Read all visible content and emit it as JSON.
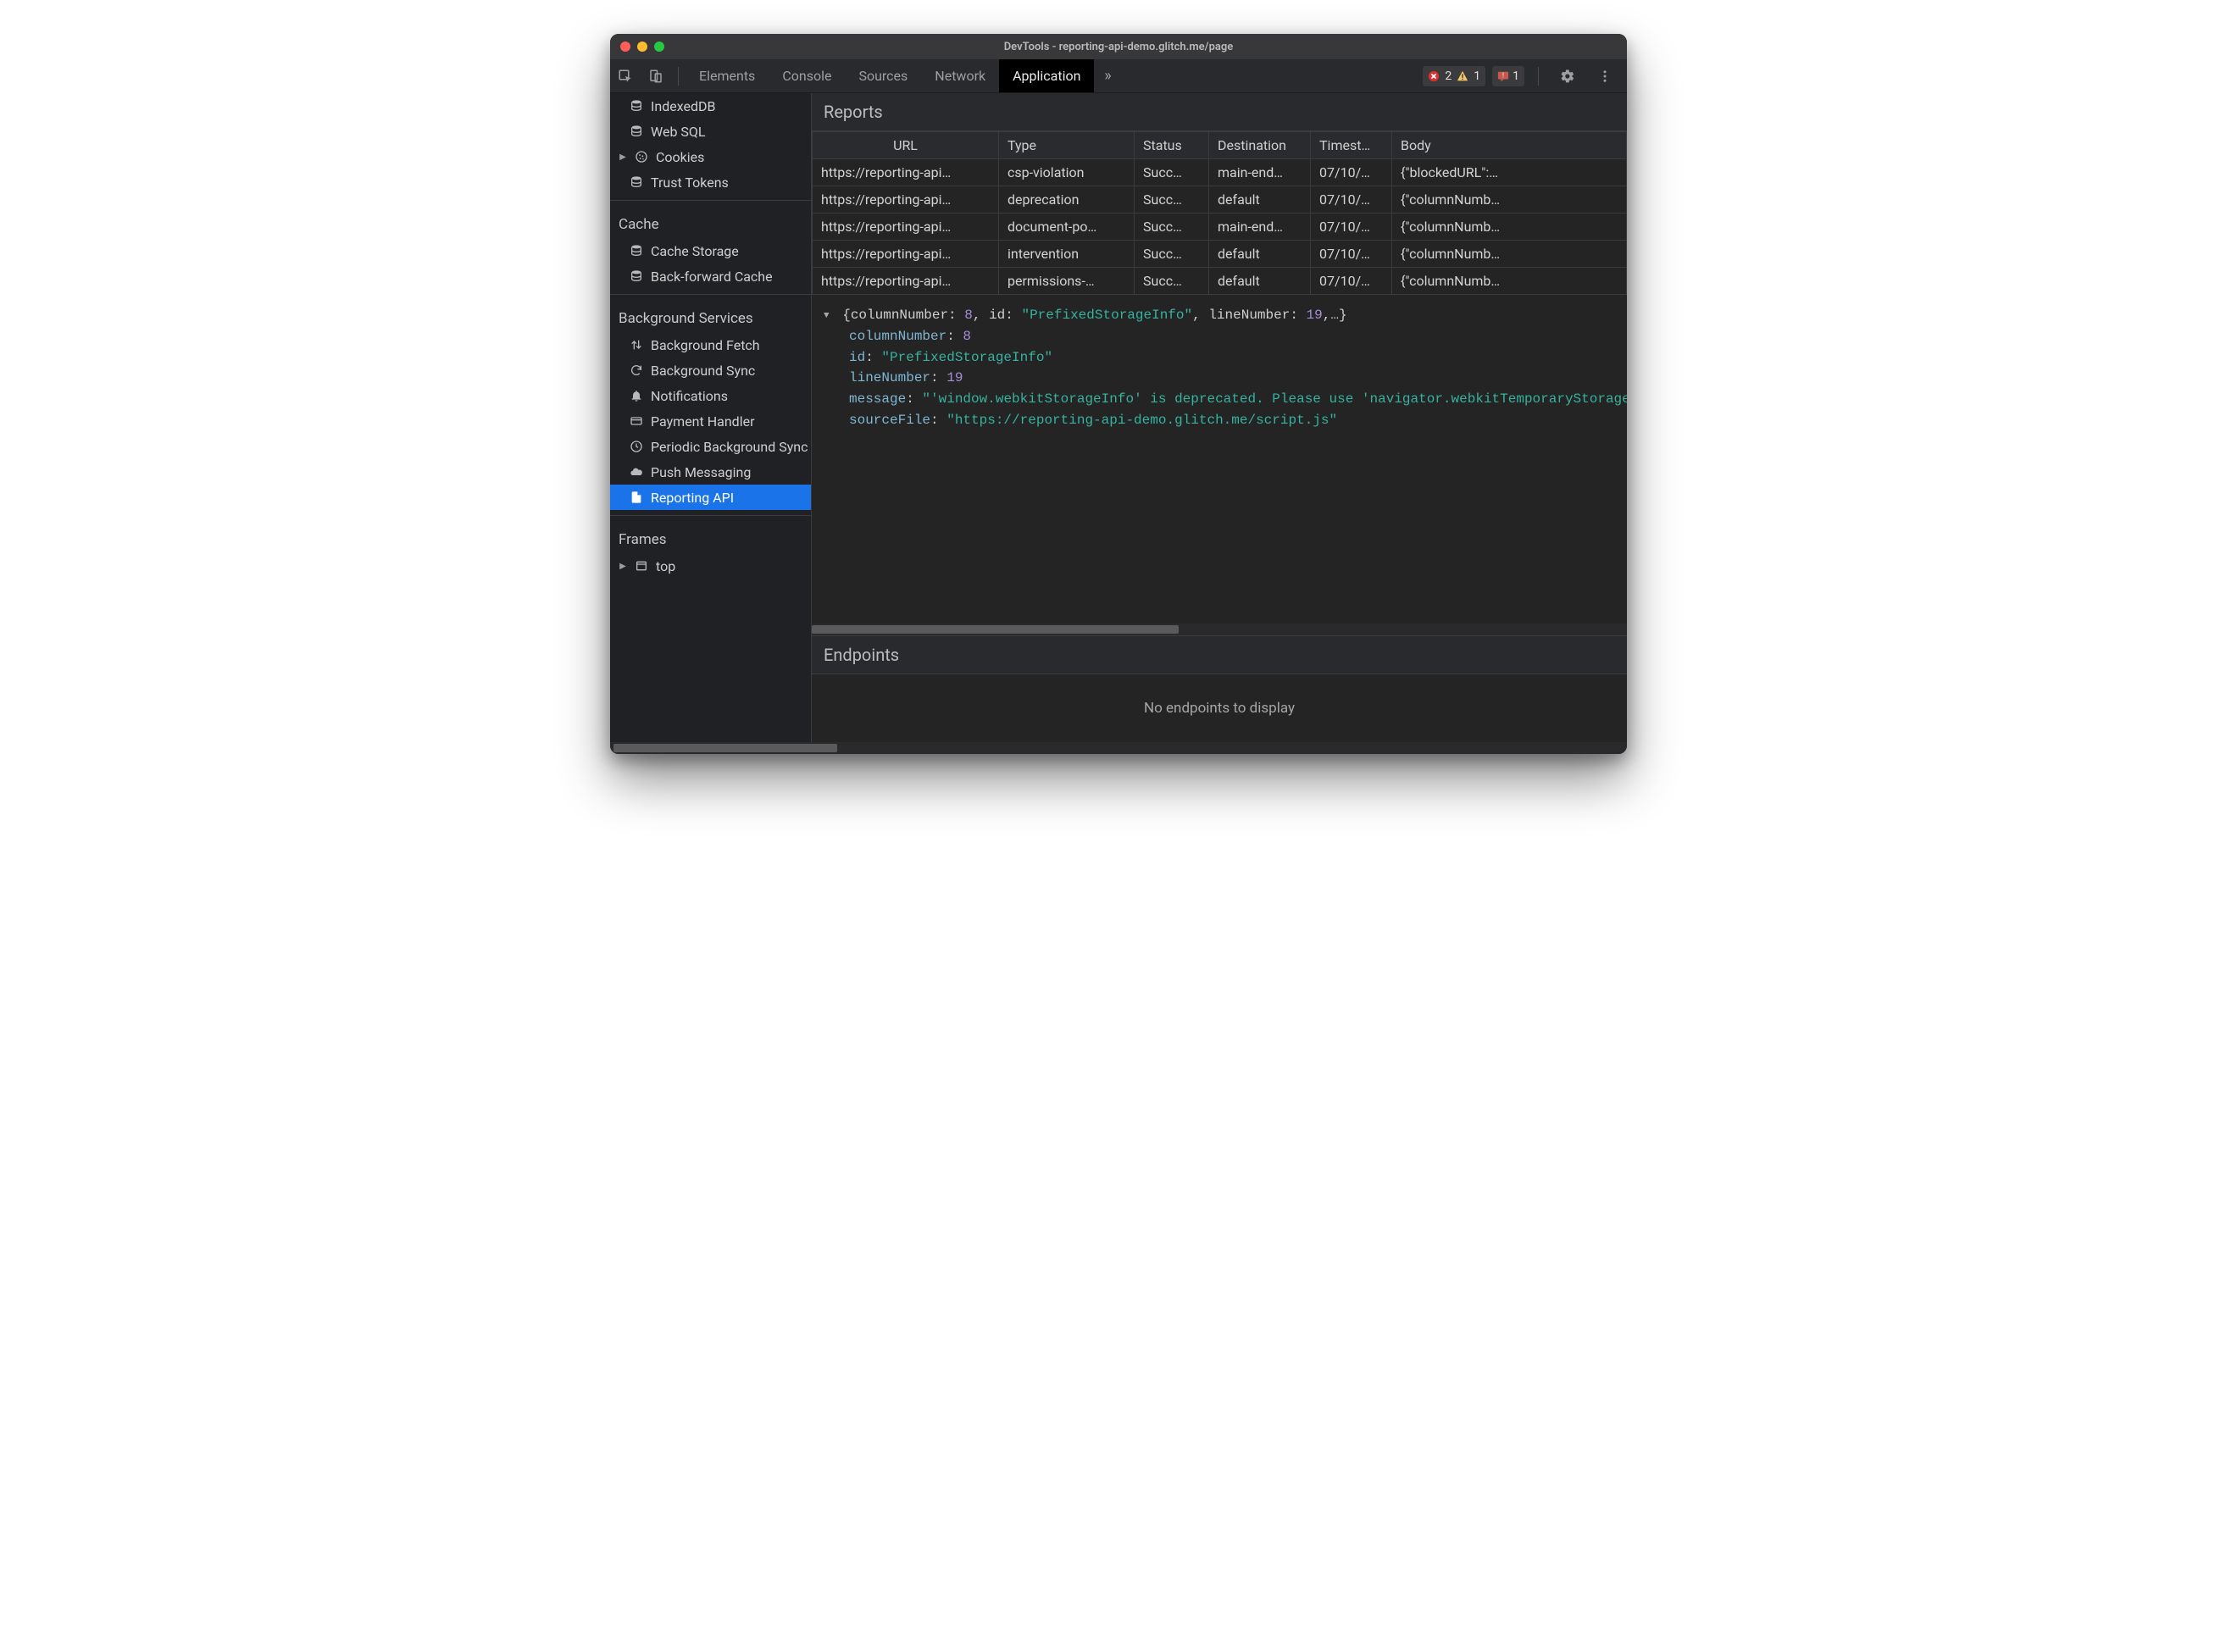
{
  "window": {
    "title": "DevTools - reporting-api-demo.glitch.me/page"
  },
  "toolbar": {
    "tabs": [
      {
        "label": "Elements"
      },
      {
        "label": "Console"
      },
      {
        "label": "Sources"
      },
      {
        "label": "Network"
      },
      {
        "label": "Application",
        "active": true
      }
    ],
    "more_label": "»",
    "error_count": "2",
    "warning_count": "1",
    "issues_count": "1"
  },
  "sidebar": {
    "storage_items": [
      {
        "label": "IndexedDB",
        "icon": "db"
      },
      {
        "label": "Web SQL",
        "icon": "db"
      },
      {
        "label": "Cookies",
        "icon": "cookie",
        "expandable": true
      },
      {
        "label": "Trust Tokens",
        "icon": "db"
      }
    ],
    "cache_title": "Cache",
    "cache_items": [
      {
        "label": "Cache Storage",
        "icon": "db"
      },
      {
        "label": "Back-forward Cache",
        "icon": "db"
      }
    ],
    "bg_title": "Background Services",
    "bg_items": [
      {
        "label": "Background Fetch",
        "icon": "updown"
      },
      {
        "label": "Background Sync",
        "icon": "sync"
      },
      {
        "label": "Notifications",
        "icon": "bell"
      },
      {
        "label": "Payment Handler",
        "icon": "card"
      },
      {
        "label": "Periodic Background Sync",
        "icon": "clock"
      },
      {
        "label": "Push Messaging",
        "icon": "cloud"
      },
      {
        "label": "Reporting API",
        "icon": "file",
        "selected": true
      }
    ],
    "frames_title": "Frames",
    "frames_items": [
      {
        "label": "top",
        "icon": "frame",
        "expandable": true
      }
    ]
  },
  "reports": {
    "title": "Reports",
    "columns": [
      "URL",
      "Type",
      "Status",
      "Destination",
      "Timestamp",
      "Body"
    ],
    "column_display": [
      "URL",
      "Type",
      "Status",
      "Destination",
      "Timest…",
      "Body"
    ],
    "rows": [
      {
        "url": "https://reporting-api…",
        "type": "csp-violation",
        "status": "Succ…",
        "destination": "main-end…",
        "timestamp": "07/10/…",
        "body": "{\"blockedURL\":…"
      },
      {
        "url": "https://reporting-api…",
        "type": "deprecation",
        "status": "Succ…",
        "destination": "default",
        "timestamp": "07/10/…",
        "body": "{\"columnNumb…"
      },
      {
        "url": "https://reporting-api…",
        "type": "document-po…",
        "status": "Succ…",
        "destination": "main-end…",
        "timestamp": "07/10/…",
        "body": "{\"columnNumb…"
      },
      {
        "url": "https://reporting-api…",
        "type": "intervention",
        "status": "Succ…",
        "destination": "default",
        "timestamp": "07/10/…",
        "body": "{\"columnNumb…"
      },
      {
        "url": "https://reporting-api…",
        "type": "permissions-…",
        "status": "Succ…",
        "destination": "default",
        "timestamp": "07/10/…",
        "body": "{\"columnNumb…"
      }
    ]
  },
  "detail": {
    "summary_prefix": "{columnNumber: ",
    "summary_col": "8",
    "summary_mid1": ", id: ",
    "summary_id": "\"PrefixedStorageInfo\"",
    "summary_mid2": ", lineNumber: ",
    "summary_line": "19",
    "summary_suffix": ",…}",
    "k_columnNumber": "columnNumber",
    "v_columnNumber": "8",
    "k_id": "id",
    "v_id": "\"PrefixedStorageInfo\"",
    "k_lineNumber": "lineNumber",
    "v_lineNumber": "19",
    "k_message": "message",
    "v_message": "\"'window.webkitStorageInfo' is deprecated. Please use 'navigator.webkitTemporaryStorage' or 'navigator.webkitPersistentStorage' instead.\"",
    "k_sourceFile": "sourceFile",
    "v_sourceFile": "\"https://reporting-api-demo.glitch.me/script.js\""
  },
  "endpoints": {
    "title": "Endpoints",
    "empty": "No endpoints to display"
  }
}
